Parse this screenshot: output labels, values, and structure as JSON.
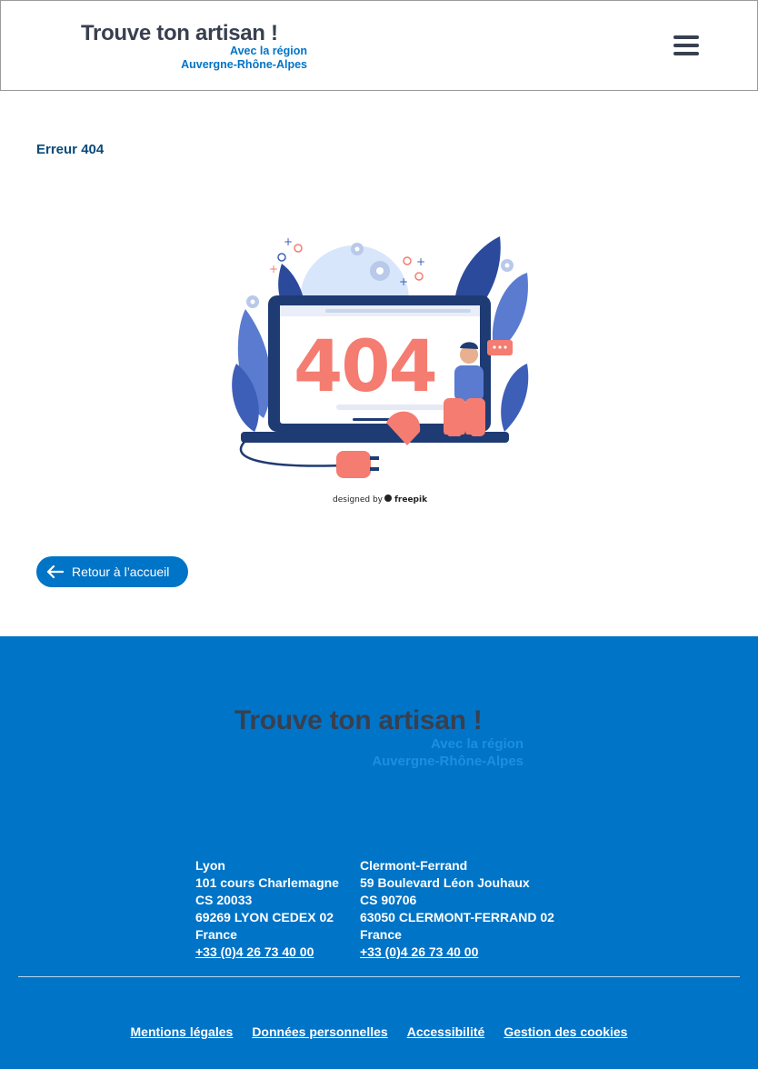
{
  "header": {
    "logo_title": "Trouve ton artisan !",
    "logo_line2": "Avec la région",
    "logo_line3": "Auvergne-Rhône-Alpes"
  },
  "main": {
    "error_title": "Erreur 404",
    "illustration": {
      "code": "404",
      "credit_prefix": "designed by",
      "credit_brand": "freepik"
    },
    "back_button": "Retour à l’accueil"
  },
  "footer": {
    "logo_title": "Trouve ton artisan !",
    "logo_line2": "Avec la région",
    "logo_line3": "Auvergne-Rhône-Alpes",
    "addresses": [
      {
        "city": "Lyon",
        "street": "101 cours Charlemagne",
        "box": "CS 20033",
        "postal": "69269 LYON CEDEX 02",
        "country": "France",
        "phone": "+33 (0)4 26 73 40 00"
      },
      {
        "city": "Clermont-Ferrand",
        "street": "59 Boulevard Léon Jouhaux",
        "box": "CS 90706",
        "postal": "63050 CLERMONT-FERRAND 02",
        "country": "France",
        "phone": "+33 (0)4 26 73 40 00"
      }
    ],
    "links": [
      "Mentions légales",
      "Données personnelles",
      "Accessibilité",
      "Gestion des cookies"
    ]
  },
  "colors": {
    "brand_blue": "#0074c7",
    "dark_text": "#384050",
    "error_coral": "#f47c70"
  },
  "icons": {
    "menu": "hamburger-menu-icon",
    "back": "arrow-left-icon"
  }
}
